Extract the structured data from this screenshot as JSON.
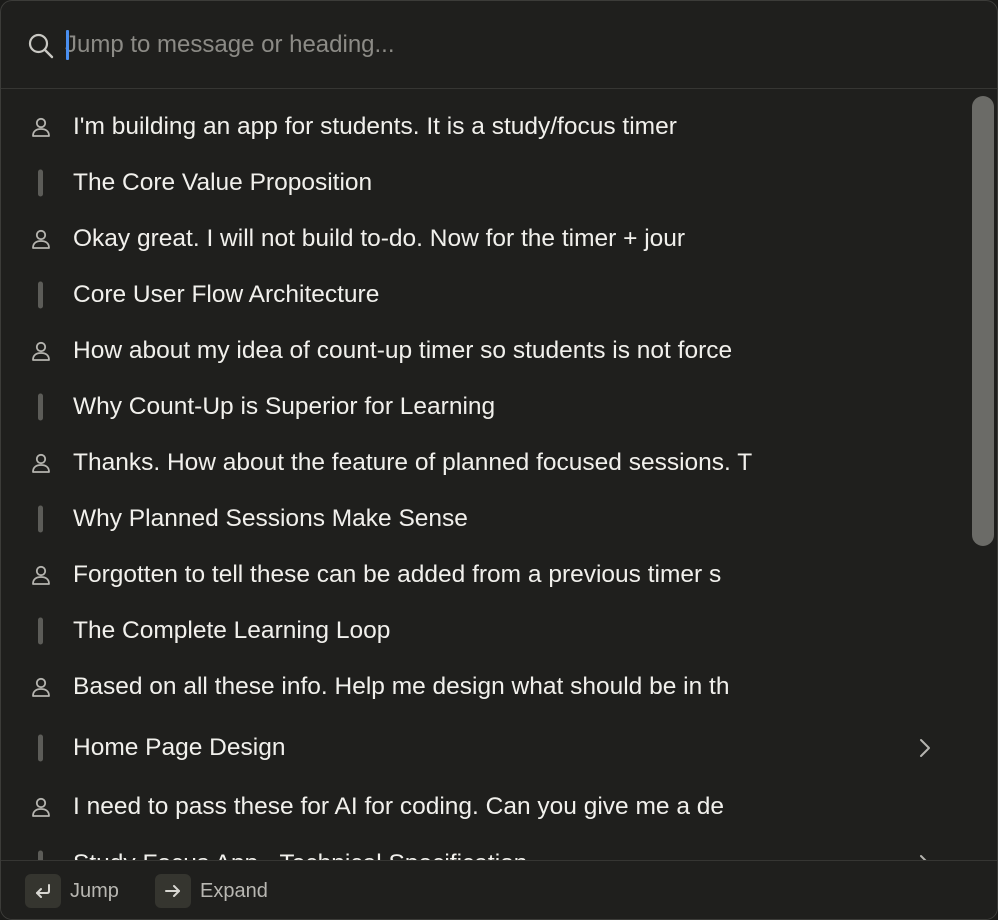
{
  "search": {
    "placeholder": "Jump to message or heading...",
    "value": ""
  },
  "items": [
    {
      "type": "message",
      "icon": "user-icon",
      "text": "I'm building an app for students. It is a study/focus timer"
    },
    {
      "type": "heading",
      "icon": "heading-bar",
      "text": "The Core Value Proposition"
    },
    {
      "type": "message",
      "icon": "user-icon",
      "text": "Okay great. I will not build to-do. Now for the timer + jour"
    },
    {
      "type": "heading",
      "icon": "heading-bar",
      "text": "Core User Flow Architecture"
    },
    {
      "type": "message",
      "icon": "user-icon",
      "text": "How about my idea of count-up timer so students is not force"
    },
    {
      "type": "heading",
      "icon": "heading-bar",
      "text": "Why Count-Up is Superior for Learning"
    },
    {
      "type": "message",
      "icon": "user-icon",
      "text": "Thanks. How about the feature of planned focused sessions. T"
    },
    {
      "type": "heading",
      "icon": "heading-bar",
      "text": "Why Planned Sessions Make Sense"
    },
    {
      "type": "message",
      "icon": "user-icon",
      "text": "Forgotten to tell these can be added from a previous timer s"
    },
    {
      "type": "heading",
      "icon": "heading-bar",
      "text": "The Complete Learning Loop"
    },
    {
      "type": "message",
      "icon": "user-icon",
      "text": "Based on all these info. Help me design what should be in th"
    },
    {
      "type": "heading",
      "icon": "heading-bar",
      "text": "Home Page Design",
      "expandable": true
    },
    {
      "type": "message",
      "icon": "user-icon",
      "text": "I need to pass these for AI for coding. Can you give me a de"
    },
    {
      "type": "heading",
      "icon": "heading-bar",
      "text": "Study Focus App - Technical Specification",
      "expandable": true,
      "partially_visible": true
    }
  ],
  "footer": {
    "jump": {
      "key_icon": "return-icon",
      "label": "Jump"
    },
    "expand": {
      "key_icon": "arrow-right-icon",
      "label": "Expand"
    }
  },
  "colors": {
    "background": "#1f1f1d",
    "text": "#f1f0ec",
    "muted": "#8c8b86",
    "caret": "#4a8ff0",
    "scrollbar": "#6b6b67"
  }
}
